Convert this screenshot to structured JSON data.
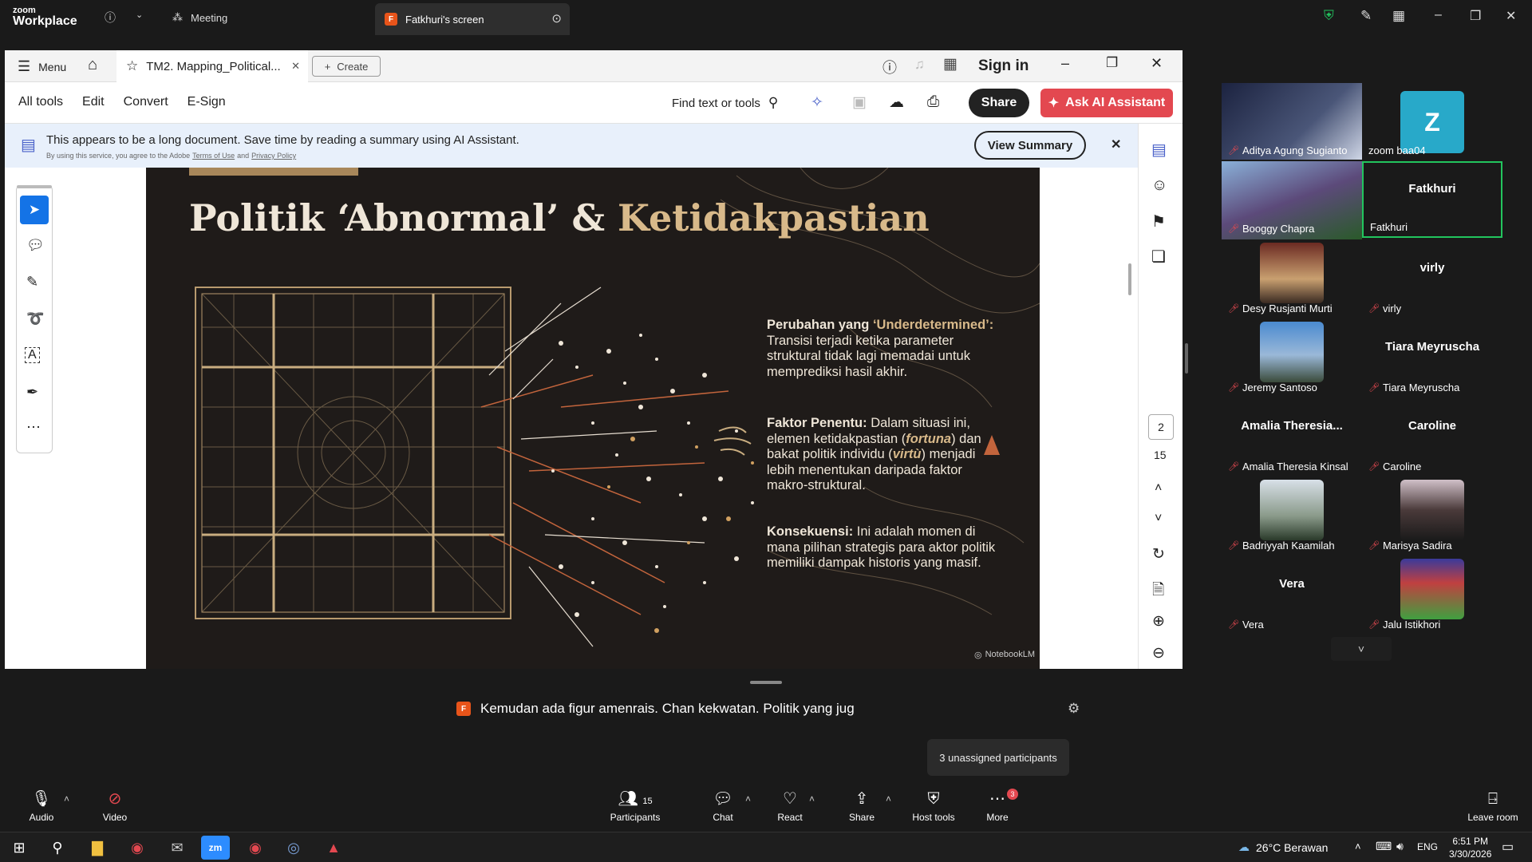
{
  "zoom": {
    "brand_top": "zoom",
    "brand_bottom": "Workplace",
    "tab_meeting": "Meeting",
    "tab_screen": "Fatkhuri's screen",
    "tab_screen_badge": "F",
    "accent": "#2d8cff"
  },
  "acrobat": {
    "menu_label": "Menu",
    "doc_tab": "TM2. Mapping_Political...",
    "create_label": "Create",
    "sign_in": "Sign in",
    "tools": [
      "All tools",
      "Edit",
      "Convert",
      "E-Sign"
    ],
    "find_label": "Find text or tools",
    "share_label": "Share",
    "ask_ai_label": "Ask AI Assistant",
    "banner_text": "This appears to be a long document. Save time by reading a summary using AI Assistant.",
    "banner_sub_prefix": "By using this service, you agree to the Adobe",
    "banner_terms": "Terms of Use",
    "banner_and": "and",
    "banner_privacy": "Privacy Policy",
    "view_summary": "View Summary",
    "page_current": "2",
    "page_total": "15"
  },
  "slide": {
    "title_part1": "Politik ‘Abnormal’ &",
    "title_part2": "Ketidakpastian",
    "p1_head": "Perubahan yang",
    "p1_em": "‘Underdetermined’:",
    "p1_body": "Transisi terjadi ketika parameter struktural tidak lagi memadai untuk memprediksi hasil akhir.",
    "p2_head": "Faktor Penentu:",
    "p2_body_a": "Dalam situasi ini, elemen ketidakpastian (",
    "p2_fortuna": "fortuna",
    "p2_body_b": ") dan bakat politik individu (",
    "p2_virtu": "virtù",
    "p2_body_c": ") menjadi lebih menentukan daripada faktor makro-struktural.",
    "p3_head": "Konsekuensi:",
    "p3_body": "Ini adalah momen di mana pilihan strategis para aktor politik memiliki dampak historis yang masif.",
    "watermark": "NotebookLM",
    "gold": "#d8b98a",
    "bg": "#1f1b19"
  },
  "gallery": [
    {
      "name": "Aditya Agung Sugianto",
      "type": "video",
      "muted": true
    },
    {
      "name": "zoom baa04",
      "type": "avatar",
      "avatar": "Z",
      "muted": false
    },
    {
      "name": "Booggy Chapra",
      "type": "video",
      "muted": true
    },
    {
      "name": "Fatkhuri",
      "type": "name",
      "center": "Fatkhuri",
      "muted": false,
      "active": true
    },
    {
      "name": "Desy Rusjanti Murti",
      "type": "video",
      "muted": true
    },
    {
      "name": "virly",
      "type": "name",
      "center": "virly",
      "muted": true
    },
    {
      "name": "Jeremy Santoso",
      "type": "video",
      "muted": true
    },
    {
      "name": "Tiara Meyruscha",
      "type": "name",
      "center": "Tiara Meyruscha",
      "muted": true
    },
    {
      "name": "Amalia Theresia Kinsal",
      "type": "name",
      "center": "Amalia  Theresia...",
      "muted": true
    },
    {
      "name": "Caroline",
      "type": "name",
      "center": "Caroline",
      "muted": true
    },
    {
      "name": "Badriyyah Kaamilah",
      "type": "video",
      "muted": true
    },
    {
      "name": "Marisya Sadira",
      "type": "video",
      "muted": true
    },
    {
      "name": "Vera",
      "type": "name",
      "center": "Vera",
      "muted": true
    },
    {
      "name": "Jalu Istikhori",
      "type": "video",
      "muted": true
    }
  ],
  "caption": {
    "badge": "F",
    "text": "Kemudan ada figur amenrais. Chan kekwatan. Politik yang jug"
  },
  "tooltip": "3 unassigned participants",
  "toolbar": {
    "audio": "Audio",
    "video": "Video",
    "participants": "Participants",
    "participants_count": "15",
    "chat": "Chat",
    "react": "React",
    "share": "Share",
    "host_tools": "Host tools",
    "more": "More",
    "more_badge": "3",
    "leave": "Leave room"
  },
  "taskbar": {
    "weather": "26°C  Berawan",
    "lang": "ENG",
    "time": "6:51 PM",
    "date": "3/30/2026"
  }
}
